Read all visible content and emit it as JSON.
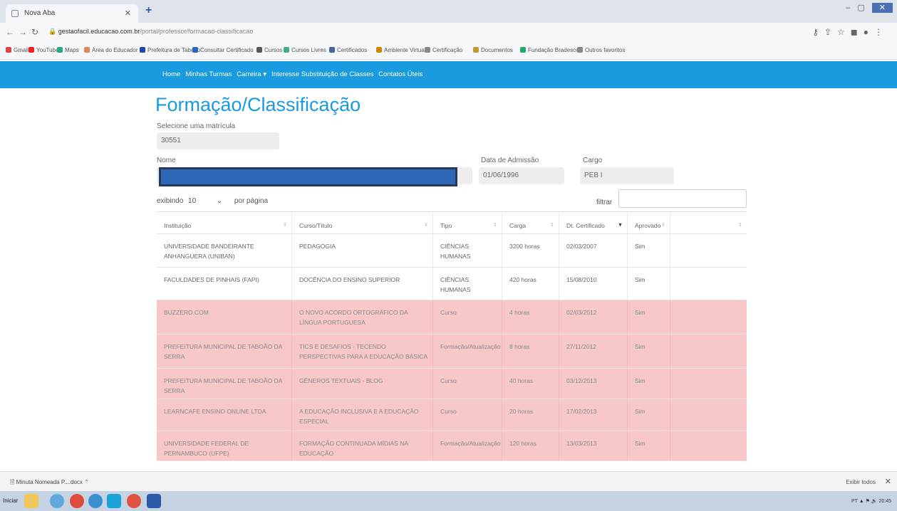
{
  "browser": {
    "tab_title": "Nova Aba",
    "url_domain": "gestaofacil.educacao.com.br",
    "url_path": "/portal/professor/formacao-classificacao",
    "bookmarks": [
      "Gmail",
      "YouTube",
      "Maps",
      "Área do Educador",
      "Prefeitura de Taboão",
      "Consultar Certificado",
      "Cursos",
      "Cursos Livres",
      "Certificados",
      "Ambiente Virtual",
      "Certificação",
      "Documentos",
      "Fundação Bradesco",
      "Outros favoritos"
    ]
  },
  "nav": {
    "items": [
      "Home",
      "Minhas Turmas",
      "Carreira ▾",
      "Interesse Substituição de Classes",
      "Contatos Úteis"
    ]
  },
  "page": {
    "title": "Formação/Classificação",
    "matricula_label": "Selecione uma matrícula",
    "matricula_value": "30551",
    "nome_label": "Nome",
    "admissao_label": "Data de Admissão",
    "admissao_value": "01/06/1996",
    "cargo_label": "Cargo",
    "cargo_value": "PEB I"
  },
  "controls": {
    "exibindo_label": "exibindo",
    "page_size": "10",
    "por_pagina": "por página",
    "filtrar_label": "filtrar"
  },
  "table": {
    "headers": [
      "Instituição",
      "Curso/Título",
      "Tipo",
      "Carga",
      "Dt. Certificado",
      "Aprovado"
    ],
    "rows": [
      {
        "inst": "UNIVERSIDADE BANDEIRANTE ANHANGUERA (UNIBAN)",
        "curso": "PEDAGOGIA",
        "tipo": "CIÊNCIAS HUMANAS",
        "carga": "3200 horas",
        "data": "02/03/2007",
        "aprov": "Sim"
      },
      {
        "inst": "FACULDADES DE PINHAIS (FAPI)",
        "curso": "DOCÊNCIA DO ENSINO SUPERIOR",
        "tipo": "CIÊNCIAS HUMANAS",
        "carga": "420 horas",
        "data": "15/08/2010",
        "aprov": "Sim"
      },
      {
        "inst": "BUZZERO.COM",
        "curso": "O NOVO ACORDO ORTOGRÁFICO DA LÍNGUA PORTUGUESA",
        "tipo": "Curso",
        "carga": "4 horas",
        "data": "02/03/2012",
        "aprov": "Sim"
      },
      {
        "inst": "PREFEITURA MUNICIPAL DE TABOÃO DA SERRA",
        "curso": "TICS E DESAFIOS - TECENDO PERSPECTIVAS PARA A EDUCAÇÃO BÁSICA",
        "tipo": "Formação/Atualização",
        "carga": "8 horas",
        "data": "27/11/2012",
        "aprov": "Sim"
      },
      {
        "inst": "PREFEITURA MUNICIPAL DE TABOÃO DA SERRA",
        "curso": "GÊNEROS TEXTUAIS - BLOG",
        "tipo": "Curso",
        "carga": "40 horas",
        "data": "03/12/2013",
        "aprov": "Sim"
      },
      {
        "inst": "LEARNCAFE ENSINO ONLINE LTDA",
        "curso": "A EDUCAÇÃO INCLUSIVA E A EDUCAÇÃO ESPECIAL",
        "tipo": "Curso",
        "carga": "20 horas",
        "data": "17/02/2013",
        "aprov": "Sim"
      },
      {
        "inst": "UNIVERSIDADE FEDERAL DE PERNAMBUCO (UFPE)",
        "curso": "FORMAÇÃO CONTINUADA MÍDIAS NA EDUCAÇÃO",
        "tipo": "Formação/Atualização",
        "carga": "120 horas",
        "data": "13/03/2013",
        "aprov": "Sim"
      }
    ]
  },
  "downloads": {
    "item": "Minuta Nomeada P....docx",
    "show_all": "Exibir todos"
  },
  "taskbar": {
    "start": "Iniciar",
    "tray": "PT  ▲  ⚑  🔊  20:45"
  },
  "colors": {
    "brand": "#1a9be0",
    "highlight_row": "#f8c8c8"
  }
}
